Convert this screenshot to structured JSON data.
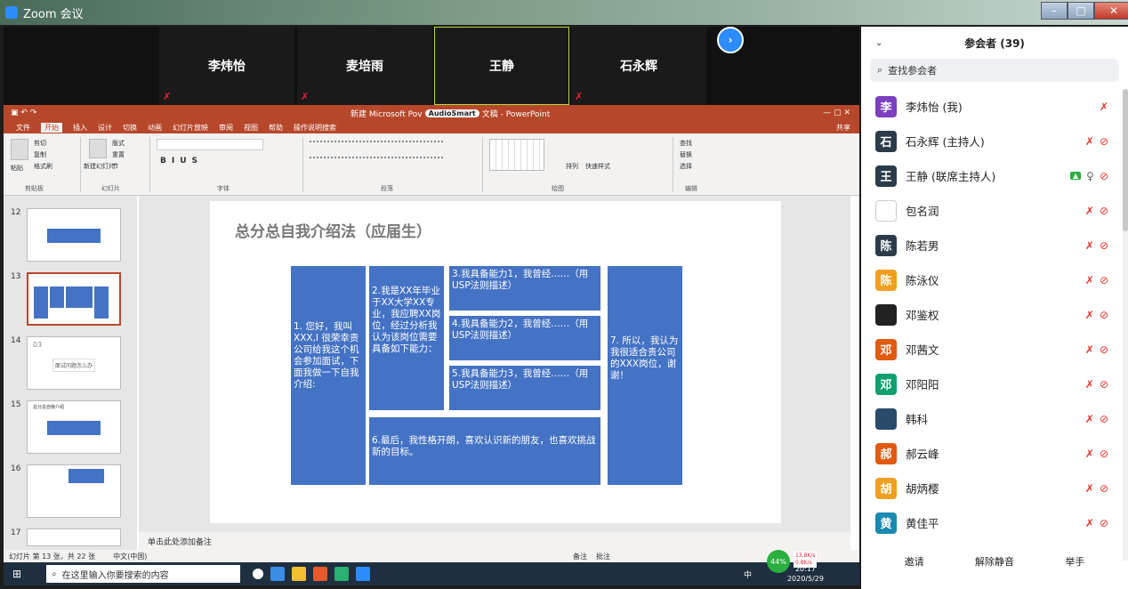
{
  "window": {
    "title": "Zoom 会议"
  },
  "videos": [
    {
      "name": "李炜怡"
    },
    {
      "name": "麦培雨"
    },
    {
      "name": "王静"
    },
    {
      "name": "石永辉"
    }
  ],
  "ppt": {
    "title_left": "新建 Microsoft Pov",
    "audiotag": "AudioSmart",
    "title_right": "文稿 - PowerPoint",
    "menus": [
      "文件",
      "开始",
      "插入",
      "设计",
      "切换",
      "动画",
      "幻灯片放映",
      "审阅",
      "视图",
      "帮助",
      "操作说明搜索"
    ],
    "share_label": "共享",
    "ribbon_groups": [
      "剪贴板",
      "幻灯片",
      "字体",
      "段落",
      "绘图",
      "编辑"
    ],
    "ribbon_labels": {
      "cut": "剪切",
      "copy": "复制",
      "painter": "格式刷",
      "paste": "粘贴",
      "new_slide": "新建幻灯片",
      "layout": "版式",
      "reset": "重置",
      "section": "节",
      "arrange": "排列",
      "quick_style": "快速样式",
      "find": "查找",
      "replace": "替换",
      "select": "选择"
    },
    "thumbnails": [
      {
        "num": "12"
      },
      {
        "num": "13"
      },
      {
        "num": "14",
        "text": "03",
        "sub": "面试问题怎么办"
      },
      {
        "num": "15",
        "text": "总分总自我介绍"
      },
      {
        "num": "16"
      },
      {
        "num": "17"
      }
    ],
    "slide": {
      "title": "总分总自我介绍法（应届生）",
      "boxes": [
        "1.\n 您好，我叫XXX,I 很荣幸贵公司给我这个机会参加面试，下面我做一下自我介绍:",
        "2.我是XX年毕业于XX大学XX专业，我应聘XX岗位，经过分析我认为该岗位需要具备如下能力：",
        "3.我具备能力1，我曾经……（用USP法则描述）",
        "4.我具备能力2，我曾经……（用USP法则描述）",
        "5.我具备能力3，我曾经……（用USP法则描述）",
        "6.最后，我性格开朗，喜欢认识新的朋友，也喜欢挑战新的目标。",
        "7.\n 所以，我认为我很适合贵公司的XXX岗位，谢谢！"
      ]
    },
    "notes": "单击此处添加备注",
    "status_left": "幻灯片 第 13 张，共 22 张",
    "status_lang": "中文(中国)",
    "status_right": [
      "备注",
      "批注"
    ],
    "taskbar_search": "在这里输入你要搜索的内容",
    "network": {
      "percent": "44%",
      "up": "13.8K/s",
      "down": "0.8K/s"
    },
    "clock": {
      "time": "20:17",
      "date": "2020/5/29"
    },
    "ime": "中"
  },
  "panel": {
    "title": "参会者 (39)",
    "search_placeholder": "查找参会者",
    "participants": [
      {
        "avatar": "李",
        "name": "李炜怡 (我)",
        "color": "#7b3fbf",
        "video": false
      },
      {
        "avatar": "石",
        "name": "石永辉 (主持人)",
        "color": "#2b3b4a",
        "video": true
      },
      {
        "avatar": "王",
        "name": "王静 (联席主持人)",
        "color": "#2b3b4a",
        "video": true,
        "share": true
      },
      {
        "avatar": "",
        "name": "包名润",
        "color": "#ffffff",
        "video": true
      },
      {
        "avatar": "陈",
        "name": "陈若男",
        "color": "#2b3b4a",
        "video": true
      },
      {
        "avatar": "陈",
        "name": "陈泳仪",
        "color": "#f0a020",
        "video": true
      },
      {
        "avatar": "",
        "name": "邓鉴权",
        "color": "#222222",
        "video": true
      },
      {
        "avatar": "邓",
        "name": "邓茜文",
        "color": "#e05a10",
        "video": true
      },
      {
        "avatar": "邓",
        "name": "邓阳阳",
        "color": "#10a070",
        "video": true
      },
      {
        "avatar": "",
        "name": "韩科",
        "color": "#2a4a6a",
        "video": true
      },
      {
        "avatar": "郝",
        "name": "郝云峰",
        "color": "#e05a10",
        "video": true
      },
      {
        "avatar": "胡",
        "name": "胡炳樱",
        "color": "#f0a020",
        "video": true
      },
      {
        "avatar": "黄",
        "name": "黄佳平",
        "color": "#1a8ab0",
        "video": true
      }
    ],
    "footer": [
      "邀请",
      "解除静音",
      "举手"
    ]
  }
}
